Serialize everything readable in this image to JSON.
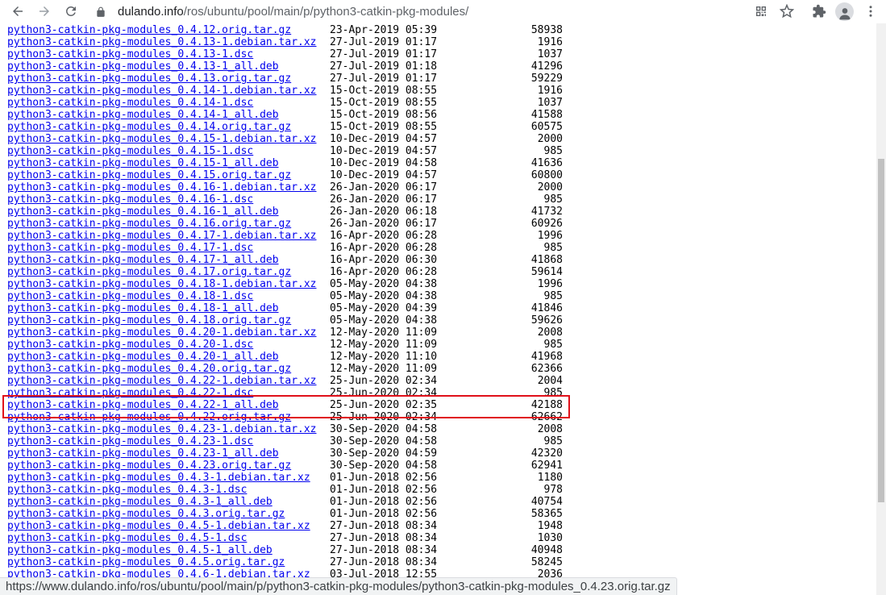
{
  "browser": {
    "address_host": "dulando.info",
    "address_path": "/ros/ubuntu/pool/main/p/python3-catkin-pkg-modules/",
    "icons": [
      "back-icon",
      "forward-icon",
      "reload-icon",
      "lock-icon",
      "qr-icon",
      "star-icon",
      "extensions-icon",
      "profile-icon",
      "menu-icon"
    ]
  },
  "status_url": "https://www.dulando.info/ros/ubuntu/pool/main/p/python3-catkin-pkg-modules/python3-catkin-pkg-modules_0.4.23.orig.tar.gz",
  "highlight_color": "#e0101a",
  "listing": [
    {
      "name": "python3-catkin-pkg-modules_0.4.12.orig.tar.gz",
      "date": "23-Apr-2019 05:39",
      "size": "58938"
    },
    {
      "name": "python3-catkin-pkg-modules_0.4.13-1.debian.tar.xz",
      "date": "27-Jul-2019 01:17",
      "size": "1916"
    },
    {
      "name": "python3-catkin-pkg-modules_0.4.13-1.dsc",
      "date": "27-Jul-2019 01:17",
      "size": "1037"
    },
    {
      "name": "python3-catkin-pkg-modules_0.4.13-1_all.deb",
      "date": "27-Jul-2019 01:18",
      "size": "41296"
    },
    {
      "name": "python3-catkin-pkg-modules_0.4.13.orig.tar.gz",
      "date": "27-Jul-2019 01:17",
      "size": "59229"
    },
    {
      "name": "python3-catkin-pkg-modules_0.4.14-1.debian.tar.xz",
      "date": "15-Oct-2019 08:55",
      "size": "1916"
    },
    {
      "name": "python3-catkin-pkg-modules_0.4.14-1.dsc",
      "date": "15-Oct-2019 08:55",
      "size": "1037"
    },
    {
      "name": "python3-catkin-pkg-modules_0.4.14-1_all.deb",
      "date": "15-Oct-2019 08:56",
      "size": "41588"
    },
    {
      "name": "python3-catkin-pkg-modules_0.4.14.orig.tar.gz",
      "date": "15-Oct-2019 08:55",
      "size": "60575"
    },
    {
      "name": "python3-catkin-pkg-modules_0.4.15-1.debian.tar.xz",
      "date": "10-Dec-2019 04:57",
      "size": "2000"
    },
    {
      "name": "python3-catkin-pkg-modules_0.4.15-1.dsc",
      "date": "10-Dec-2019 04:57",
      "size": "985"
    },
    {
      "name": "python3-catkin-pkg-modules_0.4.15-1_all.deb",
      "date": "10-Dec-2019 04:58",
      "size": "41636"
    },
    {
      "name": "python3-catkin-pkg-modules_0.4.15.orig.tar.gz",
      "date": "10-Dec-2019 04:57",
      "size": "60800"
    },
    {
      "name": "python3-catkin-pkg-modules_0.4.16-1.debian.tar.xz",
      "date": "26-Jan-2020 06:17",
      "size": "2000"
    },
    {
      "name": "python3-catkin-pkg-modules_0.4.16-1.dsc",
      "date": "26-Jan-2020 06:17",
      "size": "985"
    },
    {
      "name": "python3-catkin-pkg-modules_0.4.16-1_all.deb",
      "date": "26-Jan-2020 06:18",
      "size": "41732"
    },
    {
      "name": "python3-catkin-pkg-modules_0.4.16.orig.tar.gz",
      "date": "26-Jan-2020 06:17",
      "size": "60926"
    },
    {
      "name": "python3-catkin-pkg-modules_0.4.17-1.debian.tar.xz",
      "date": "16-Apr-2020 06:28",
      "size": "1996"
    },
    {
      "name": "python3-catkin-pkg-modules_0.4.17-1.dsc",
      "date": "16-Apr-2020 06:28",
      "size": "985"
    },
    {
      "name": "python3-catkin-pkg-modules_0.4.17-1_all.deb",
      "date": "16-Apr-2020 06:30",
      "size": "41868"
    },
    {
      "name": "python3-catkin-pkg-modules_0.4.17.orig.tar.gz",
      "date": "16-Apr-2020 06:28",
      "size": "59614"
    },
    {
      "name": "python3-catkin-pkg-modules_0.4.18-1.debian.tar.xz",
      "date": "05-May-2020 04:38",
      "size": "1996"
    },
    {
      "name": "python3-catkin-pkg-modules_0.4.18-1.dsc",
      "date": "05-May-2020 04:38",
      "size": "985"
    },
    {
      "name": "python3-catkin-pkg-modules_0.4.18-1_all.deb",
      "date": "05-May-2020 04:39",
      "size": "41846"
    },
    {
      "name": "python3-catkin-pkg-modules_0.4.18.orig.tar.gz",
      "date": "05-May-2020 04:38",
      "size": "59626"
    },
    {
      "name": "python3-catkin-pkg-modules_0.4.20-1.debian.tar.xz",
      "date": "12-May-2020 11:09",
      "size": "2008"
    },
    {
      "name": "python3-catkin-pkg-modules_0.4.20-1.dsc",
      "date": "12-May-2020 11:09",
      "size": "985"
    },
    {
      "name": "python3-catkin-pkg-modules_0.4.20-1_all.deb",
      "date": "12-May-2020 11:10",
      "size": "41968"
    },
    {
      "name": "python3-catkin-pkg-modules_0.4.20.orig.tar.gz",
      "date": "12-May-2020 11:09",
      "size": "62366"
    },
    {
      "name": "python3-catkin-pkg-modules_0.4.22-1.debian.tar.xz",
      "date": "25-Jun-2020 02:34",
      "size": "2004"
    },
    {
      "name": "python3-catkin-pkg-modules_0.4.22-1.dsc",
      "date": "25-Jun-2020 02:34",
      "size": "985"
    },
    {
      "name": "python3-catkin-pkg-modules_0.4.22-1_all.deb",
      "date": "25-Jun-2020 02:35",
      "size": "42188"
    },
    {
      "name": "python3-catkin-pkg-modules_0.4.22.orig.tar.gz",
      "date": "25-Jun-2020 02:34",
      "size": "62662"
    },
    {
      "name": "python3-catkin-pkg-modules_0.4.23-1.debian.tar.xz",
      "date": "30-Sep-2020 04:58",
      "size": "2008"
    },
    {
      "name": "python3-catkin-pkg-modules_0.4.23-1.dsc",
      "date": "30-Sep-2020 04:58",
      "size": "985"
    },
    {
      "name": "python3-catkin-pkg-modules_0.4.23-1_all.deb",
      "date": "30-Sep-2020 04:59",
      "size": "42320"
    },
    {
      "name": "python3-catkin-pkg-modules_0.4.23.orig.tar.gz",
      "date": "30-Sep-2020 04:58",
      "size": "62941"
    },
    {
      "name": "python3-catkin-pkg-modules_0.4.3-1.debian.tar.xz",
      "date": "01-Jun-2018 02:56",
      "size": "1180"
    },
    {
      "name": "python3-catkin-pkg-modules_0.4.3-1.dsc",
      "date": "01-Jun-2018 02:56",
      "size": "978"
    },
    {
      "name": "python3-catkin-pkg-modules_0.4.3-1_all.deb",
      "date": "01-Jun-2018 02:56",
      "size": "40754"
    },
    {
      "name": "python3-catkin-pkg-modules_0.4.3.orig.tar.gz",
      "date": "01-Jun-2018 02:56",
      "size": "58365"
    },
    {
      "name": "python3-catkin-pkg-modules_0.4.5-1.debian.tar.xz",
      "date": "27-Jun-2018 08:34",
      "size": "1948"
    },
    {
      "name": "python3-catkin-pkg-modules_0.4.5-1.dsc",
      "date": "27-Jun-2018 08:34",
      "size": "1030"
    },
    {
      "name": "python3-catkin-pkg-modules_0.4.5-1_all.deb",
      "date": "27-Jun-2018 08:34",
      "size": "40948"
    },
    {
      "name": "python3-catkin-pkg-modules_0.4.5.orig.tar.gz",
      "date": "27-Jun-2018 08:34",
      "size": "58245"
    },
    {
      "name": "python3-catkin-pkg-modules_0.4.6-1.debian.tar.xz",
      "date": "03-Jul-2018 12:55",
      "size": "2036"
    }
  ]
}
